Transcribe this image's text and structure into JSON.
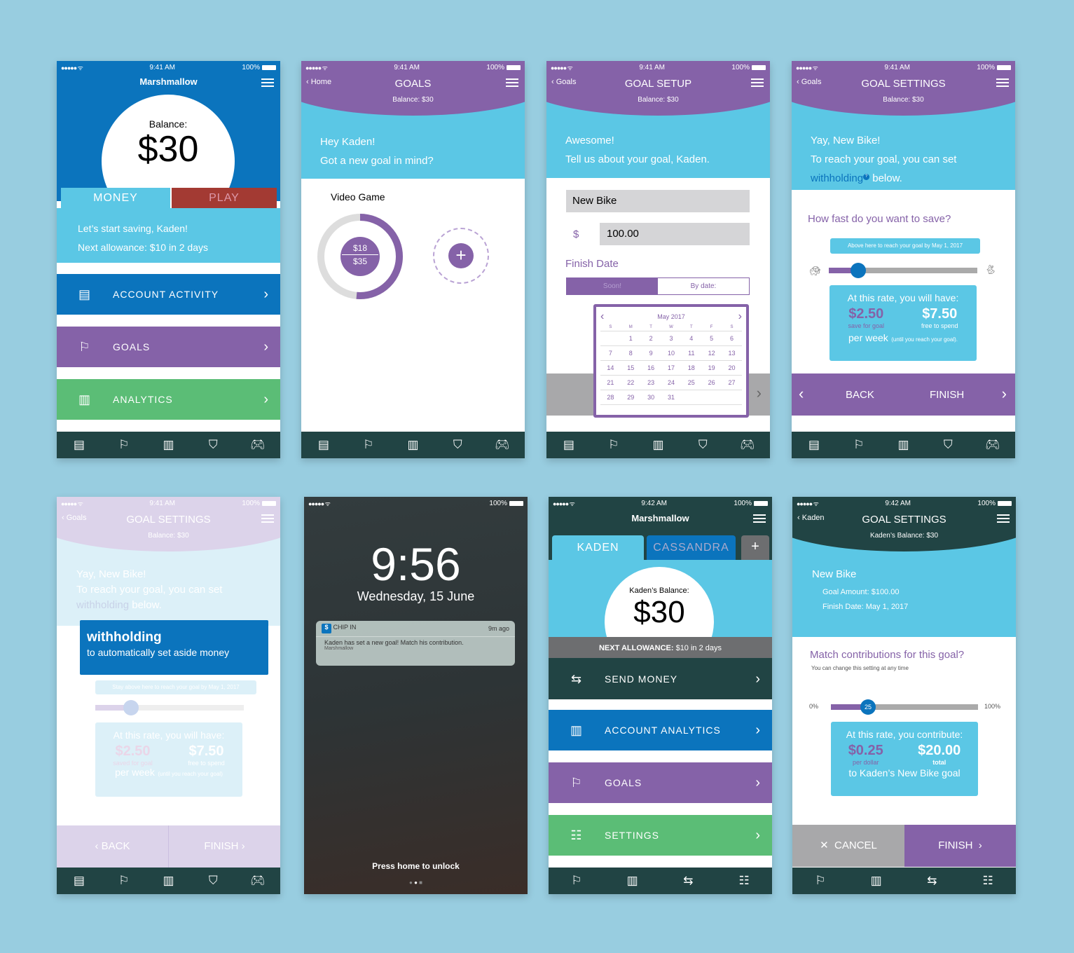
{
  "colors": {
    "background": "#98cde0",
    "blue": "#0b74bd",
    "purple": "#8562a8",
    "green": "#5bbd76",
    "teal": "#5bc7e5",
    "dark": "#214444",
    "red": "#a33a33"
  },
  "status": {
    "signal": "●●●●● ᯤ",
    "battery": "100%"
  },
  "tabbar_icons": {
    "receipt": "🧾",
    "flag": "⚑",
    "chart": "📊",
    "badge": "🛡",
    "gamepad": "🎮",
    "send_money": "⟲$⟳",
    "settings": "☰"
  },
  "screen1": {
    "time": "9:41 AM",
    "title": "Marshmallow",
    "balance_label": "Balance:",
    "balance": "$30",
    "tab_money": "MONEY",
    "tab_play": "PLAY",
    "line1": "Let’s start saving, Kaden!",
    "line2": "Next allowance: $10 in 2 days",
    "menu": [
      {
        "label": "ACCOUNT ACTIVITY",
        "icon": "receipt-icon"
      },
      {
        "label": "GOALS",
        "icon": "flag-icon"
      },
      {
        "label": "ANALYTICS",
        "icon": "bar-chart-icon"
      }
    ]
  },
  "screen2": {
    "time": "9:41 AM",
    "back": "Home",
    "title": "GOALS",
    "balance": "Balance: $30",
    "line1": "Hey Kaden!",
    "line2": "Got a new goal in mind?",
    "goal_name": "Video Game",
    "saved": "$18",
    "target": "$35",
    "progress": 0.514,
    "add": "+"
  },
  "screen3": {
    "time": "9:41 AM",
    "back": "Goals",
    "title": "GOAL SETUP",
    "balance": "Balance: $30",
    "line1": "Awesome!",
    "line2": "Tell us about your goal, Kaden.",
    "goal_name": "New Bike",
    "currency": "$",
    "amount": "100.00",
    "finish_label": "Finish Date",
    "opt_soon": "Soon!",
    "opt_date": "By date:",
    "calendar": {
      "month": "May 2017",
      "weekdays": [
        "S",
        "M",
        "T",
        "W",
        "T",
        "F",
        "S"
      ],
      "weeks": [
        [
          "",
          "1",
          "2",
          "3",
          "4",
          "5",
          "6"
        ],
        [
          "7",
          "8",
          "9",
          "10",
          "11",
          "12",
          "13"
        ],
        [
          "14",
          "15",
          "16",
          "17",
          "18",
          "19",
          "20"
        ],
        [
          "21",
          "22",
          "23",
          "24",
          "25",
          "26",
          "27"
        ],
        [
          "28",
          "29",
          "30",
          "31",
          "",
          "",
          ""
        ]
      ]
    }
  },
  "screen4": {
    "time": "9:41 AM",
    "back": "Goals",
    "title": "GOAL SETTINGS",
    "balance": "Balance: $30",
    "line1": "Yay, New Bike!",
    "line2": "To reach your goal, you can set",
    "link": "withholding",
    "line3": " below.",
    "question": "How fast do you want to save?",
    "hint": "Above here to reach your goal by May 1, 2017",
    "slider_value": 0.2,
    "rate_title": "At this rate, you will have:",
    "save_amount": "$2.50",
    "save_label": "save for goal",
    "spend_amount": "$7.50",
    "spend_label": "free to spend",
    "per_week": "per week",
    "until": "(until you reach your goal).",
    "back_btn": "BACK",
    "finish_btn": "FINISH"
  },
  "screen5": {
    "time": "9:41 AM",
    "back": "Goals",
    "title": "GOAL SETTINGS",
    "balance": "Balance: $30",
    "line1": "Yay, New Bike!",
    "line2": "To reach your goal, you can set",
    "link": "withholding",
    "line3": " below.",
    "tooltip_term": "withholding",
    "tooltip_def": "to automatically set aside money",
    "hint": "Stay above here to reach your goal by May 1, 2017",
    "rate_title": "At this rate, you will have:",
    "save_amount": "$2.50",
    "save_label": "saved for goal",
    "spend_amount": "$7.50",
    "spend_label": "free to spend",
    "per_week": "per week",
    "until": "(until you reach your goal)",
    "back_btn": "BACK",
    "finish_btn": "FINISH"
  },
  "screen6": {
    "clock": "9:56",
    "date": "Wednesday, 15 June",
    "app": "CHIP IN",
    "ago": "9m ago",
    "message": "Kaden has set a new goal!  Match his contribution.",
    "source": "Marshmallow",
    "unlock": "Press home to unlock"
  },
  "screen7": {
    "time": "9:42 AM",
    "title": "Marshmallow",
    "tab1": "KADEN",
    "tab2": "CASSANDRA",
    "tab_add": "+",
    "balance_label": "Kaden’s Balance:",
    "balance": "$30",
    "allowance_bold": "NEXT ALLOWANCE:",
    "allowance": " $10 in 2 days",
    "menu": [
      {
        "label": "SEND MONEY"
      },
      {
        "label": "ACCOUNT ANALYTICS"
      },
      {
        "label": "GOALS"
      },
      {
        "label": "SETTINGS"
      }
    ]
  },
  "screen8": {
    "time": "9:42 AM",
    "back": "Kaden",
    "title": "GOAL SETTINGS",
    "balance": "Kaden’s Balance: $30",
    "goal": "New Bike",
    "amount": "Goal Amount: $100.00",
    "date": "Finish Date: May 1, 2017",
    "question": "Match contributions for this goal?",
    "note": "You can change this setting at any time",
    "min": "0%",
    "max": "100%",
    "slider_value": "25",
    "rate_title": "At this rate, you contribute:",
    "per_amount": "$0.25",
    "per_label": "per dollar",
    "total_amount": "$20.00",
    "total_label": "total",
    "to_goal": "to Kaden’s New Bike goal",
    "cancel": "CANCEL",
    "finish": "FINISH"
  }
}
